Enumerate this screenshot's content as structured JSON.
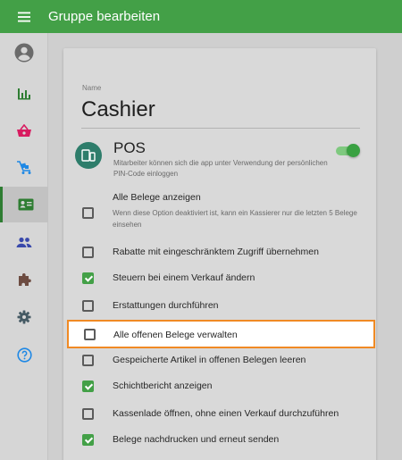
{
  "appbar": {
    "title": "Gruppe bearbeiten",
    "menu_icon": "menu-icon",
    "color": "#43a047"
  },
  "sidebar": {
    "items": [
      {
        "icon": "account-circle-icon",
        "active": false,
        "color": "#6b6b6b"
      },
      {
        "icon": "bar-chart-icon",
        "active": false,
        "color": "#2e7d32"
      },
      {
        "icon": "shopping-basket-icon",
        "active": false,
        "color": "#d81b60"
      },
      {
        "icon": "items-cart-icon",
        "active": false,
        "color": "#1e88e5"
      },
      {
        "icon": "employee-card-icon",
        "active": true,
        "color": "#2e7d32"
      },
      {
        "icon": "people-icon",
        "active": false,
        "color": "#3949ab"
      },
      {
        "icon": "puzzle-icon",
        "active": false,
        "color": "#6d4c41"
      },
      {
        "icon": "settings-icon",
        "active": false,
        "color": "#455a64"
      },
      {
        "icon": "help-icon",
        "active": false,
        "color": "#1e88e5"
      }
    ]
  },
  "form": {
    "name_label": "Name",
    "name_value": "Cashier"
  },
  "pos": {
    "icon": "pos-terminal-icon",
    "title": "POS",
    "description": "Mitarbeiter können sich die app unter Verwendung der persönlichen PIN-Code einloggen",
    "enabled": true
  },
  "permissions": [
    {
      "label": "Alle Belege anzeigen",
      "sub": "Wenn diese Option deaktiviert ist, kann ein Kassierer nur die letzten 5 Belege einsehen",
      "checked": false
    },
    {
      "label": "Rabatte mit eingeschränktem Zugriff übernehmen",
      "checked": false
    },
    {
      "label": "Steuern bei einem Verkauf ändern",
      "checked": true
    },
    {
      "label": "Erstattungen durchführen",
      "checked": false
    },
    {
      "label": "Alle offenen Belege verwalten",
      "checked": false,
      "highlighted": true
    },
    {
      "label": "Gespeicherte Artikel in offenen Belegen leeren",
      "checked": false
    },
    {
      "label": "Schichtbericht anzeigen",
      "checked": true
    },
    {
      "label": "Kassenlade öffnen, ohne einen Verkauf durchzuführen",
      "checked": false
    },
    {
      "label": "Belege nachdrucken und erneut senden",
      "checked": true
    }
  ],
  "colors": {
    "accent": "#43a047",
    "highlight_border": "#f08a24"
  }
}
